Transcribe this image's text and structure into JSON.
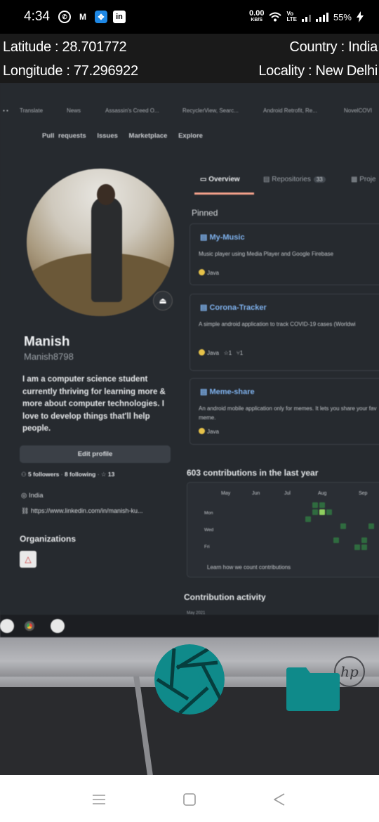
{
  "status_bar": {
    "time": "4:34",
    "net_speed": "0.00",
    "net_unit": "KB/S",
    "volte_top": "Vo",
    "volte_bottom": "LTE",
    "battery": "55%"
  },
  "location": {
    "latitude": "Latitude : 28.701772",
    "longitude": "Longitude : 77.296922",
    "country": "Country : India",
    "locality": "Locality : New Delhi"
  },
  "photo": {
    "browser_tabs": [
      "Translate",
      "News",
      "Assassin's Creed O...",
      "RecyclerView, Searc...",
      "Android Retrofit, Re...",
      "NovelCOVI"
    ],
    "nav_links": [
      "Pull requests",
      "Issues",
      "Marketplace",
      "Explore"
    ],
    "profile": {
      "name": "Manish",
      "username": "Manish8798",
      "bio": "I am a computer science student currently thriving for learning more & more about computer technologies. I love to develop things that'll help people.",
      "edit_button": "Edit profile",
      "followers": "5 followers",
      "following": "8 following",
      "stars": "13",
      "location": "India",
      "link": "https://www.linkedin.com/in/manish-ku...",
      "organizations_heading": "Organizations"
    },
    "tabs": {
      "overview": "Overview",
      "repositories": "Repositories",
      "repositories_count": "33",
      "projects": "Proje"
    },
    "pinned_heading": "Pinned",
    "pinned": [
      {
        "name": "My-Music",
        "description": "Music player using Media Player and Google Firebase",
        "language": "Java",
        "stars": "",
        "forks": ""
      },
      {
        "name": "Corona-Tracker",
        "description": "A simple android application to track COVID-19 cases (Worldwi",
        "language": "Java",
        "stars": "1",
        "forks": "1"
      },
      {
        "name": "Meme-share",
        "description": "An android mobile application only for memes. It lets you share your fav meme.",
        "language": "Java",
        "stars": "",
        "forks": ""
      }
    ],
    "contributions_heading": "603 contributions in the last year",
    "months": [
      "May",
      "Jun",
      "Jul",
      "Aug",
      "Sep"
    ],
    "days": [
      "Mon",
      "Wed",
      "Fri"
    ],
    "graph_footer": "Learn how we count contributions",
    "activity_heading": "Contribution activity",
    "activity_sub": "May 2021",
    "monitor_brand": "hp"
  },
  "colors": {
    "accent_teal": "#0f8a8a",
    "statusbar_bg": "#000000",
    "location_bar_bg": "#1a1a1a",
    "link_blue": "#7fb2ee",
    "java_yellow": "#e6c24a"
  },
  "icons": {
    "shutter": "aperture-icon",
    "gallery": "folder-icon",
    "nav_menu": "menu-lines-icon",
    "nav_home": "square-home-icon",
    "nav_back": "triangle-back-icon"
  }
}
